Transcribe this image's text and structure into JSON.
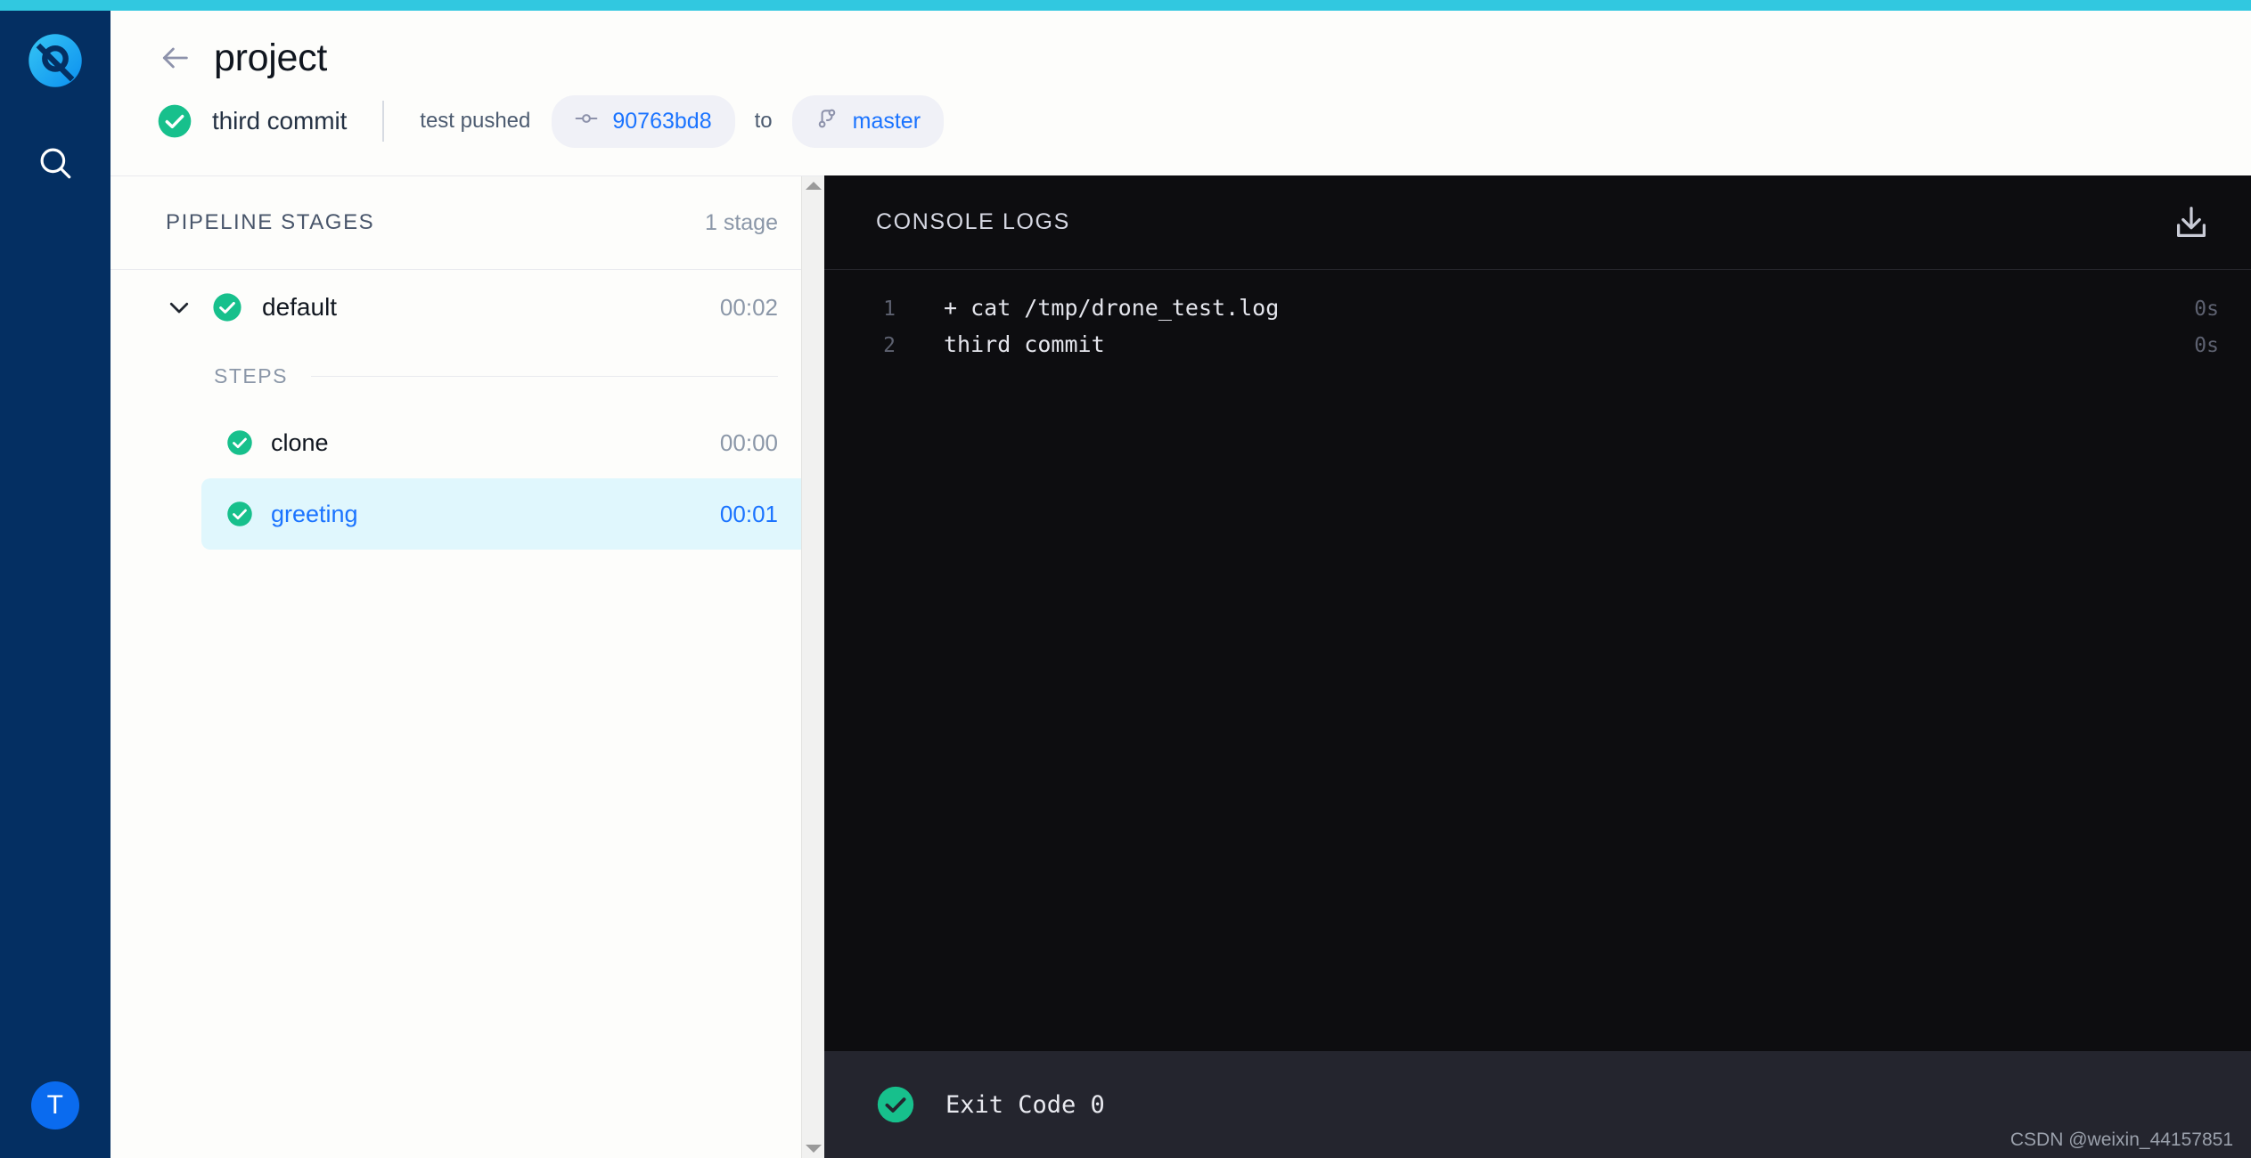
{
  "theme": {
    "accent_bar": "#31c8e0",
    "rail_bg": "#042f62",
    "link_blue": "#1a73ff",
    "success_green": "#17c08c",
    "console_bg": "#0d0d10",
    "console_footer_bg": "#24252e",
    "active_row_bg": "#e0f7fd"
  },
  "rail": {
    "logo_icon": "drone-logo-icon",
    "search_icon": "search-icon",
    "avatar_initial": "T"
  },
  "header": {
    "back_icon": "arrow-left-icon",
    "title": "project",
    "status_icon": "check-circle-icon",
    "commit_message": "third commit",
    "pushed_by": "test pushed",
    "commit_icon": "commit-node-icon",
    "commit_sha": "90763bd8",
    "to_label": "to",
    "branch_icon": "git-branch-icon",
    "branch_name": "master"
  },
  "stages": {
    "header_title": "PIPELINE STAGES",
    "header_count": "1 stage",
    "chevron_icon": "chevron-down-icon",
    "stage": {
      "status_icon": "check-circle-icon",
      "name": "default",
      "duration": "00:02"
    },
    "steps_label": "STEPS",
    "steps": [
      {
        "status_icon": "check-circle-icon",
        "name": "clone",
        "duration": "00:00",
        "active": false
      },
      {
        "status_icon": "check-circle-icon",
        "name": "greeting",
        "duration": "00:01",
        "active": true
      }
    ]
  },
  "console": {
    "header_title": "CONSOLE LOGS",
    "download_icon": "download-icon",
    "lines": [
      {
        "number": "1",
        "text": "+ cat /tmp/drone_test.log",
        "duration": "0s"
      },
      {
        "number": "2",
        "text": "third commit",
        "duration": "0s"
      }
    ],
    "footer": {
      "status_icon": "check-circle-icon",
      "text": "Exit Code 0"
    }
  },
  "watermark": "CSDN @weixin_44157851"
}
